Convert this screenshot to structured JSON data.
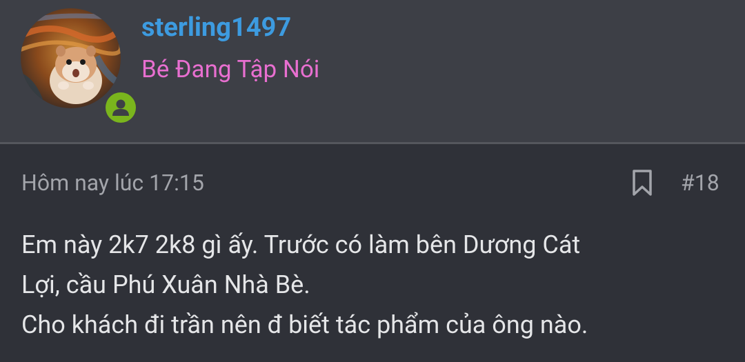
{
  "user": {
    "username": "sterling1497",
    "title": "Bé Đang Tập Nói",
    "avatar_icon": "hamster-avatar",
    "online": true
  },
  "post": {
    "timestamp": "Hôm nay lúc 17:15",
    "number": "#18",
    "bookmark_icon": "bookmark-icon",
    "body_lines": [
      "Em này 2k7 2k8 gì ấy. Trước có làm bên Dương Cát",
      "Lợi, cầu Phú Xuân Nhà Bè.",
      "Cho khách đi trần nên đ biết tác phẩm của ông nào."
    ]
  },
  "colors": {
    "background": "#2f3138",
    "header_background": "#3d3f46",
    "username": "#3d9be0",
    "user_title": "#e86fd0",
    "meta_text": "#a3a5ab",
    "body_text": "#e5e6e8",
    "online_badge": "#7ab51d"
  }
}
